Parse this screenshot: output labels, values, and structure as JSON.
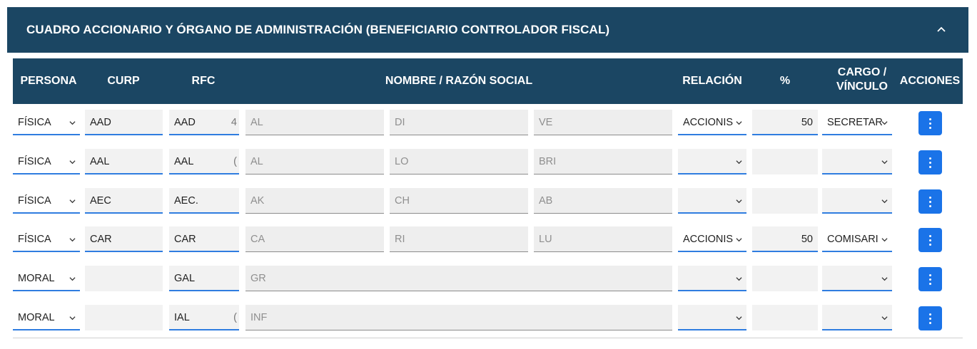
{
  "panel": {
    "title": "CUADRO ACCIONARIO Y ÓRGANO DE ADMINISTRACIÓN (BENEFICIARIO CONTROLADOR FISCAL)",
    "collapse_icon": "chevron-up-icon"
  },
  "table": {
    "headers": {
      "persona": "PERSONA",
      "curp": "CURP",
      "rfc": "RFC",
      "nombre": "NOMBRE / RAZÓN SOCIAL",
      "relacion": "RELACIÓN",
      "porcentaje": "%",
      "cargo_line1": "CARGO /",
      "cargo_line2": "VÍNCULO",
      "acciones": "ACCIONES"
    },
    "rows": [
      {
        "persona": "FÍSICA",
        "curp": "AAD",
        "rfc": "AAD",
        "rfc_tail": "4",
        "nombre1": "AL",
        "nombre2": "DI",
        "nombre3": "VE",
        "relacion": "ACCIONIS",
        "porcentaje": "50",
        "cargo": "SECRETAR"
      },
      {
        "persona": "FÍSICA",
        "curp": "AAL",
        "rfc": "AAL",
        "rfc_tail": "(",
        "nombre1": "AL",
        "nombre2": "LO",
        "nombre3": "BRI",
        "relacion": "",
        "porcentaje": "",
        "cargo": ""
      },
      {
        "persona": "FÍSICA",
        "curp": "AEC",
        "rfc": "AEC.",
        "rfc_tail": "",
        "nombre1": "AK",
        "nombre2": "CH",
        "nombre3": "AB",
        "relacion": "",
        "porcentaje": "",
        "cargo": ""
      },
      {
        "persona": "FÍSICA",
        "curp": "CAR",
        "rfc": "CAR",
        "rfc_tail": "",
        "nombre1": "CA",
        "nombre2": "RI",
        "nombre3": "LU",
        "relacion": "ACCIONIS",
        "porcentaje": "50",
        "cargo": "COMISARI"
      },
      {
        "persona": "MORAL",
        "curp": "",
        "rfc": "GAL",
        "rfc_tail": "",
        "razon_social": "GR",
        "relacion": "",
        "porcentaje": "",
        "cargo": ""
      },
      {
        "persona": "MORAL",
        "curp": "",
        "rfc": "IAL",
        "rfc_tail": "(",
        "razon_social": "INF",
        "relacion": "",
        "porcentaje": "",
        "cargo": ""
      }
    ]
  },
  "colors": {
    "header_bg": "#1b4663",
    "accent": "#1a73e8",
    "input_bg": "#f2f2f2"
  }
}
